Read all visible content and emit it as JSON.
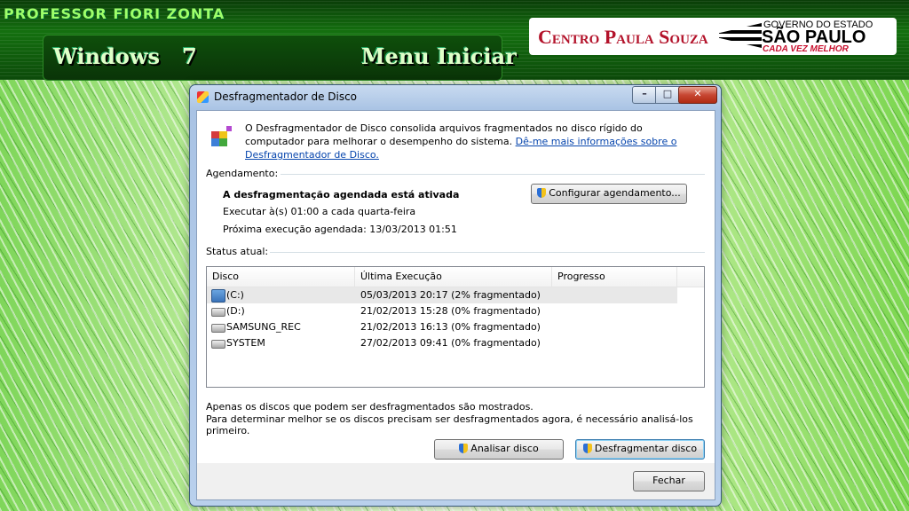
{
  "banner": {
    "professor": "PROFESSOR FIORI ZONTA",
    "left_title": "Windows   7",
    "right_title": "Menu Iniciar",
    "logo_cps": "Centro Paula Souza",
    "logo_gov_top": "GOVERNO DO ESTADO",
    "logo_gov_main": "SÃO PAULO",
    "logo_gov_sub": "CADA VEZ MELHOR"
  },
  "window": {
    "title": "Desfragmentador de Disco",
    "minimize": "–",
    "maximize": "□",
    "close": "✕"
  },
  "intro": {
    "text": "O Desfragmentador de Disco consolida arquivos fragmentados no disco rígido do computador para melhorar o desempenho do sistema. ",
    "link": "Dê-me mais informações sobre o Desfragmentador de Disco."
  },
  "schedule": {
    "heading": "Agendamento:",
    "status": "A desfragmentação agendada está ativada",
    "run": "Executar à(s) 01:00 a cada quarta-feira",
    "next": "Próxima execução agendada: 13/03/2013 01:51",
    "configure_button": "Configurar agendamento..."
  },
  "status": {
    "heading": "Status atual:",
    "columns": [
      "Disco",
      "Última Execução",
      "Progresso"
    ],
    "rows": [
      {
        "disk": "(C:)",
        "last": "05/03/2013 20:17 (2% fragmentado)",
        "progress": ""
      },
      {
        "disk": "(D:)",
        "last": "21/02/2013 15:28 (0% fragmentado)",
        "progress": ""
      },
      {
        "disk": "SAMSUNG_REC",
        "last": "21/02/2013 16:13 (0% fragmentado)",
        "progress": ""
      },
      {
        "disk": "SYSTEM",
        "last": "27/02/2013 09:41 (0% fragmentado)",
        "progress": ""
      }
    ]
  },
  "notes": {
    "line1": "Apenas os discos que podem ser desfragmentados são mostrados.",
    "line2": "Para determinar melhor se os discos precisam ser desfragmentados agora, é necessário analisá-los primeiro."
  },
  "actions": {
    "analyze": "Analisar disco",
    "defrag": "Desfragmentar disco",
    "close": "Fechar"
  }
}
